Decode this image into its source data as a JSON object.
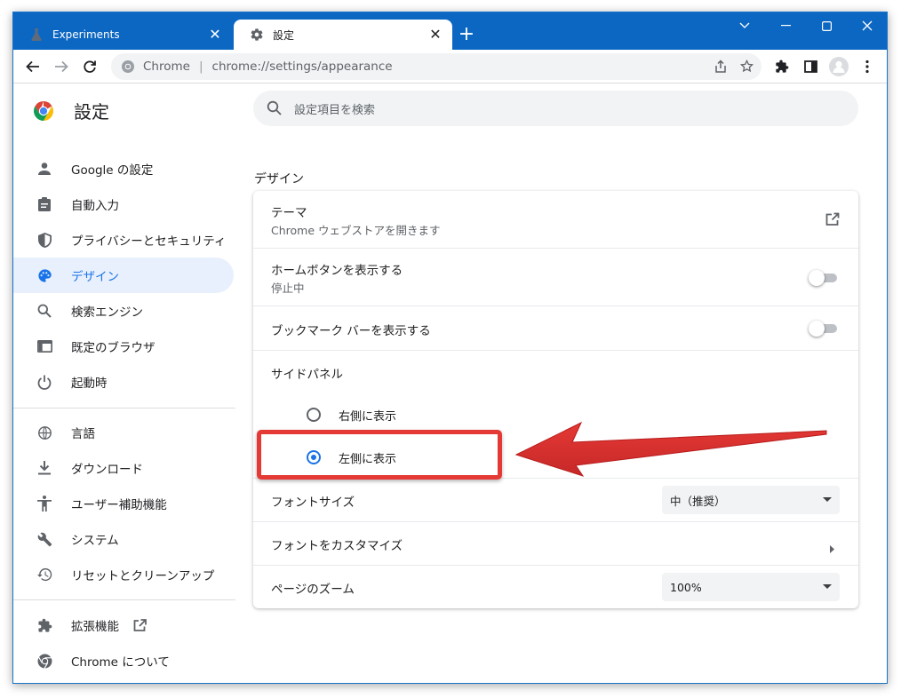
{
  "browser": {
    "tabs": [
      {
        "title": "Experiments",
        "active": false,
        "icon": "flask-icon"
      },
      {
        "title": "設定",
        "active": true,
        "icon": "gear-icon"
      }
    ],
    "new_tab_label": "+",
    "omnibox": {
      "site": "Chrome",
      "separator": "|",
      "url": "chrome://settings/appearance"
    }
  },
  "settings": {
    "title": "設定",
    "search_placeholder": "設定項目を検索",
    "nav": [
      {
        "label": "Google の設定",
        "icon": "person-icon",
        "selected": false
      },
      {
        "label": "自動入力",
        "icon": "clipboard-icon",
        "selected": false
      },
      {
        "label": "プライバシーとセキュリティ",
        "icon": "shield-icon",
        "selected": false
      },
      {
        "label": "デザイン",
        "icon": "palette-icon",
        "selected": true
      },
      {
        "label": "検索エンジン",
        "icon": "search-icon",
        "selected": false
      },
      {
        "label": "既定のブラウザ",
        "icon": "browser-icon",
        "selected": false
      },
      {
        "label": "起動時",
        "icon": "power-icon",
        "selected": false
      },
      {
        "label": "言語",
        "icon": "globe-icon",
        "selected": false
      },
      {
        "label": "ダウンロード",
        "icon": "download-icon",
        "selected": false
      },
      {
        "label": "ユーザー補助機能",
        "icon": "accessibility-icon",
        "selected": false
      },
      {
        "label": "システム",
        "icon": "wrench-icon",
        "selected": false
      },
      {
        "label": "リセットとクリーンアップ",
        "icon": "restore-icon",
        "selected": false
      },
      {
        "label": "拡張機能",
        "icon": "puzzle-icon",
        "selected": false
      },
      {
        "label": "Chrome について",
        "icon": "chrome-icon",
        "selected": false
      }
    ],
    "section_title": "デザイン",
    "theme": {
      "label": "テーマ",
      "sub": "Chrome ウェブストアを開きます"
    },
    "home_button": {
      "label": "ホームボタンを表示する",
      "sub": "停止中",
      "enabled": false
    },
    "bookmarks_bar": {
      "label": "ブックマーク バーを表示する",
      "enabled": false
    },
    "side_panel": {
      "label": "サイドパネル",
      "options": [
        {
          "label": "右側に表示",
          "checked": false
        },
        {
          "label": "左側に表示",
          "checked": true
        }
      ]
    },
    "font_size": {
      "label": "フォントサイズ",
      "value": "中（推奨）"
    },
    "customize_fonts": {
      "label": "フォントをカスタマイズ"
    },
    "page_zoom": {
      "label": "ページのズーム",
      "value": "100%"
    }
  },
  "colors": {
    "accent": "#1a73e8",
    "titlebar": "#0c67c2",
    "annotation": "#e53935"
  }
}
